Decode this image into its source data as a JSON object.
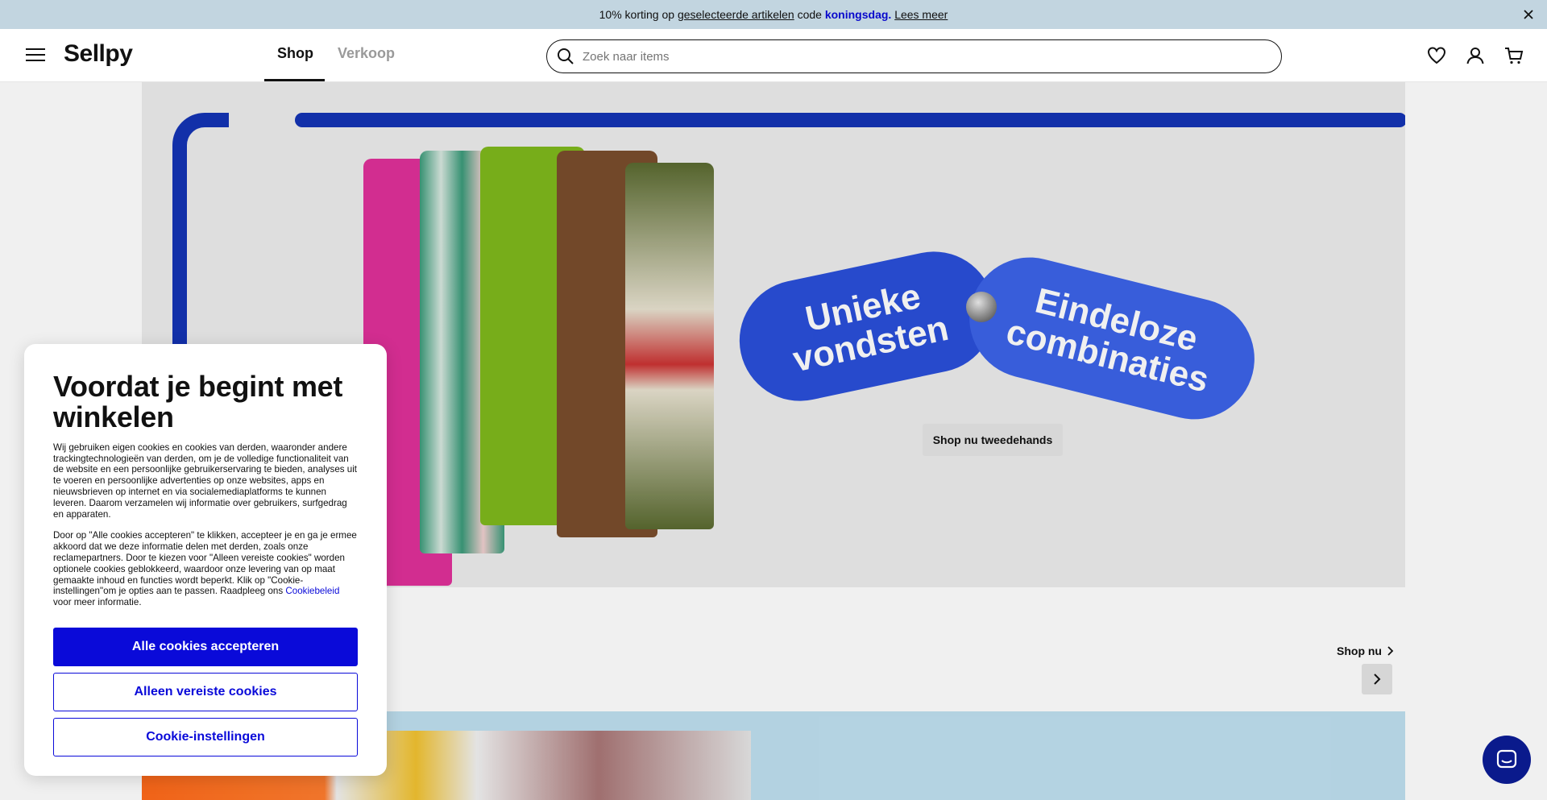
{
  "announcement": {
    "prefix": "10% korting op",
    "link": "geselecteerde artikelen",
    "mid": "code",
    "code": "koningsdag.",
    "more": "Lees meer",
    "close_icon": "close-icon"
  },
  "header": {
    "logo": "Sellpy",
    "tabs": [
      {
        "label": "Shop",
        "active": true
      },
      {
        "label": "Verkoop",
        "active": false
      }
    ],
    "search_placeholder": "Zoek naar items",
    "icons": [
      "heart-icon",
      "user-icon",
      "cart-icon"
    ]
  },
  "hero": {
    "pill_left": "Unieke vondsten",
    "pill_right": "Eindeloze combinaties",
    "cta": "Shop nu tweedehands"
  },
  "section": {
    "shop_now": "Shop nu"
  },
  "cookie_modal": {
    "title": "Voordat je begint met winkelen",
    "paragraph1": "Wij gebruiken eigen cookies en cookies van derden, waaronder andere trackingtechnologieën van derden, om je de volledige functionaliteit van de website en een persoonlijke gebruikerservaring te bieden, analyses uit te voeren en persoonlijke advertenties op onze websites, apps en nieuwsbrieven op internet en via socialemediaplatforms te kunnen leveren. Daarom verzamelen wij informatie over gebruikers, surfgedrag en apparaten.",
    "paragraph2_before_link": "Door op \"Alle cookies accepteren\" te klikken, accepteer je en ga je ermee akkoord dat we deze informatie delen met derden, zoals onze reclamepartners. Door te kiezen voor \"Alleen vereiste cookies\" worden optionele cookies geblokkeerd, waardoor onze levering van op maat gemaakte inhoud en functies wordt beperkt. Klik op \"Cookie-instellingen\"om je opties aan te passen. Raadpleeg ons",
    "policy_link": "Cookiebeleid",
    "paragraph2_after_link": "voor meer informatie.",
    "accept_all": "Alle cookies accepteren",
    "required_only": "Alleen vereiste cookies",
    "settings": "Cookie-instellingen"
  },
  "colors": {
    "accent": "#0a0ad9",
    "announcement_bg": "#cfe3ee",
    "chat_bg": "#0a1a8c"
  }
}
